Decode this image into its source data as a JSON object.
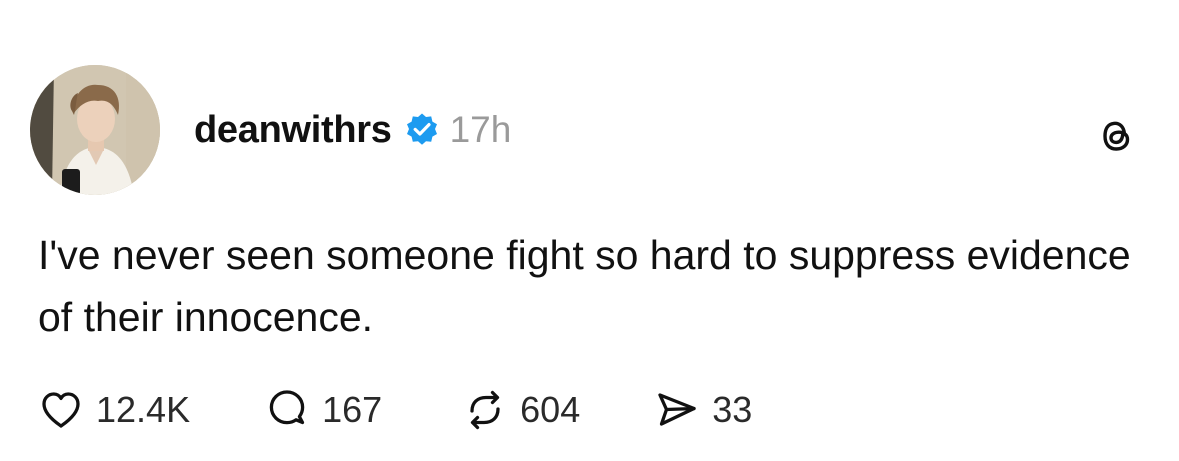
{
  "post": {
    "username": "deanwithrs",
    "verified": true,
    "timestamp": "17h",
    "text": "I've never seen someone fight so hard to suppress evidence of their innocence.",
    "actions": {
      "like_count": "12.4K",
      "reply_count": "167",
      "repost_count": "604",
      "share_count": "33"
    }
  },
  "icons": {
    "verified": "verified-badge-icon",
    "app_logo": "threads-logo-icon",
    "like": "heart-icon",
    "reply": "comment-bubble-icon",
    "repost": "repost-arrows-icon",
    "share": "paper-plane-icon"
  },
  "colors": {
    "verified_blue": "#1d9bf0",
    "timestamp_gray": "#9a9a9a",
    "text": "#111111"
  }
}
